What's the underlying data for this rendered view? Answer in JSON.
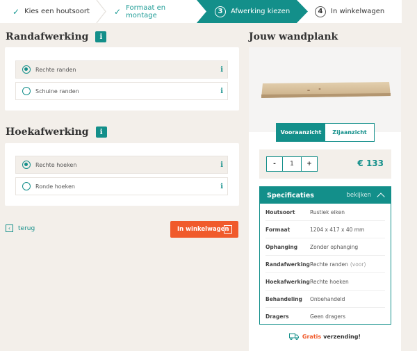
{
  "stepper": {
    "steps": [
      {
        "label": "Kies een houtsoort",
        "state": "done"
      },
      {
        "label": "Formaat en montage",
        "state": "done"
      },
      {
        "label": "Afwerking kiezen",
        "number": "3",
        "state": "active"
      },
      {
        "label": "In winkelwagen",
        "number": "4",
        "state": "todo"
      }
    ]
  },
  "edge": {
    "title": "Randafwerking",
    "info": "i",
    "options": [
      {
        "label": "Rechte randen",
        "selected": true,
        "info": "i"
      },
      {
        "label": "Schuine randen",
        "selected": false,
        "info": "i"
      }
    ]
  },
  "corner": {
    "title": "Hoekafwerking",
    "info": "i",
    "options": [
      {
        "label": "Rechte hoeken",
        "selected": true,
        "info": "i"
      },
      {
        "label": "Ronde hoeken",
        "selected": false,
        "info": "i"
      }
    ]
  },
  "nav": {
    "back_label": "terug",
    "back_icon": "‹",
    "cart_label": "In winkelwagen",
    "cart_icon": "›"
  },
  "product": {
    "title": "Jouw wandplank",
    "views": {
      "front": "Vooraanzicht",
      "side": "Zijaanzicht"
    },
    "qty": {
      "minus": "-",
      "value": "1",
      "plus": "+"
    },
    "price": "€ 133"
  },
  "specs": {
    "title": "Specificaties",
    "toggle": "bekijken",
    "rows": [
      {
        "key": "Houtsoort",
        "value": "Rustiek eiken",
        "note": ""
      },
      {
        "key": "Formaat",
        "value": "1204 x 417 x 40 mm",
        "note": ""
      },
      {
        "key": "Ophanging",
        "value": "Zonder ophanging",
        "note": ""
      },
      {
        "key": "Randafwerking",
        "value": "Rechte randen",
        "note": "(voor)"
      },
      {
        "key": "Hoekafwerking",
        "value": "Rechte hoeken",
        "note": ""
      },
      {
        "key": "Behandeling",
        "value": "Onbehandeld",
        "note": ""
      },
      {
        "key": "Dragers",
        "value": "Geen dragers",
        "note": ""
      }
    ]
  },
  "shipping": {
    "free": "Gratis",
    "label": "verzending!"
  },
  "colors": {
    "teal": "#138f8a",
    "orange": "#f05a2b",
    "background": "#f3efea"
  }
}
